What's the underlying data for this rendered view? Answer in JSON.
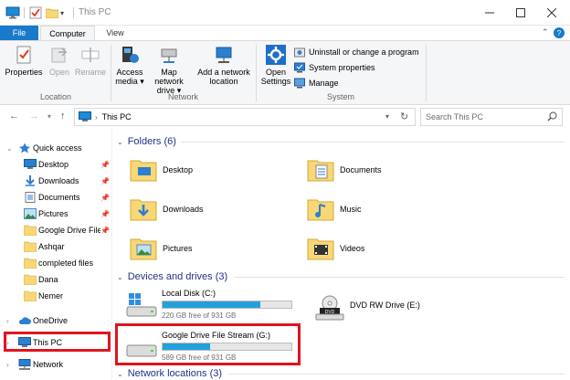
{
  "window": {
    "title": "This PC"
  },
  "ribbon_tabs": [
    "File",
    "Computer",
    "View"
  ],
  "ribbon": {
    "location": {
      "label": "Location",
      "buttons": [
        "Properties",
        "Open",
        "Rename"
      ]
    },
    "network": {
      "label": "Network",
      "buttons": [
        [
          "Access",
          "media ▾"
        ],
        [
          "Map network",
          "drive ▾"
        ],
        [
          "Add a network",
          "location"
        ]
      ]
    },
    "system": {
      "label": "System",
      "open_settings": [
        "Open",
        "Settings"
      ],
      "items": [
        "Uninstall or change a program",
        "System properties",
        "Manage"
      ]
    }
  },
  "address": {
    "path": "This PC",
    "search_placeholder": "Search This PC"
  },
  "nav": {
    "quick_access": "Quick access",
    "items": [
      "Desktop",
      "Downloads",
      "Documents",
      "Pictures",
      "Google Drive File",
      "Ashqar",
      "completed files",
      "Dana",
      "Nemer"
    ],
    "onedrive": "OneDrive",
    "this_pc": "This PC",
    "network": "Network"
  },
  "folders": {
    "header": "Folders (6)",
    "items": [
      "Desktop",
      "Documents",
      "Downloads",
      "Music",
      "Pictures",
      "Videos"
    ]
  },
  "devices": {
    "header": "Devices and drives (3)",
    "drives": [
      {
        "name": "Local Disk (C:)",
        "free": "220 GB free of 931 GB",
        "used_fraction": 0.76
      },
      {
        "name": "DVD RW Drive (E:)"
      },
      {
        "name": "Google Drive File Stream (G:)",
        "free": "589 GB free of 931 GB",
        "used_fraction": 0.37
      }
    ]
  },
  "network_locations": {
    "header": "Network locations (3)"
  },
  "colors": {
    "accent": "#1979ca",
    "folder": "#f8d775",
    "highlight": "#e0141e",
    "drive_bar": "#26a0da"
  }
}
